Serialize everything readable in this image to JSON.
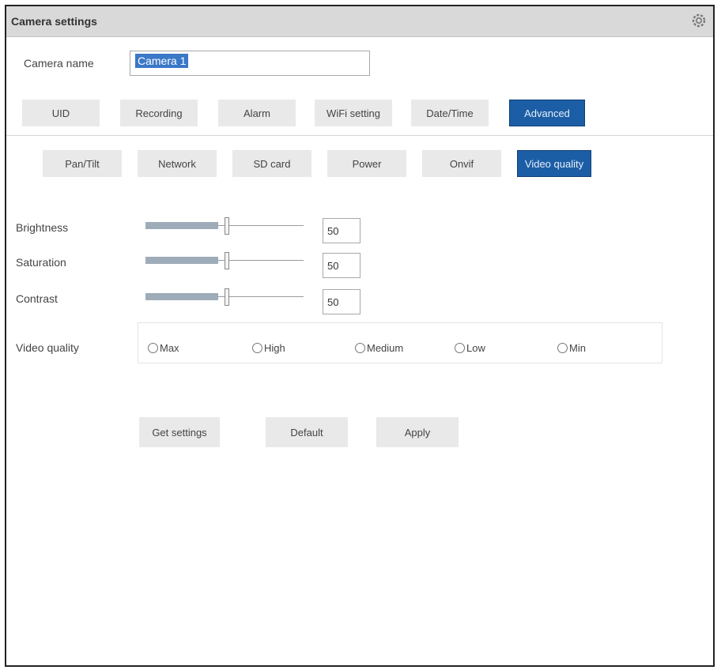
{
  "window": {
    "title": "Camera settings",
    "icon": "gear-icon"
  },
  "camera_name": {
    "label": "Camera name",
    "value": "Camera 1"
  },
  "main_tabs": [
    {
      "label": "UID",
      "active": false
    },
    {
      "label": "Recording",
      "active": false
    },
    {
      "label": "Alarm",
      "active": false
    },
    {
      "label": "WiFi setting",
      "active": false
    },
    {
      "label": "Date/Time",
      "active": false
    },
    {
      "label": "Advanced",
      "active": true
    }
  ],
  "sub_tabs": [
    {
      "label": "Pan/Tilt",
      "active": false
    },
    {
      "label": "Network",
      "active": false
    },
    {
      "label": "SD card",
      "active": false
    },
    {
      "label": "Power",
      "active": false
    },
    {
      "label": "Onvif",
      "active": false
    },
    {
      "label": "Video quality",
      "active": true
    }
  ],
  "sliders": [
    {
      "label": "Brightness",
      "value": "50",
      "level": 0.5
    },
    {
      "label": "Saturation",
      "value": "50",
      "level": 0.5
    },
    {
      "label": "Contrast",
      "value": "50",
      "level": 0.5
    }
  ],
  "video_quality": {
    "label": "Video quality",
    "options": [
      "Max",
      "High",
      "Medium",
      "Low",
      "Min"
    ],
    "selected": null
  },
  "actions": {
    "get_settings": "Get settings",
    "default": "Default",
    "apply": "Apply"
  },
  "colors": {
    "active_tab": "#1c5ea6",
    "title_bar": "#d9d9d9",
    "button": "#e9e9e9",
    "slider_fill": "#9eabb8"
  }
}
